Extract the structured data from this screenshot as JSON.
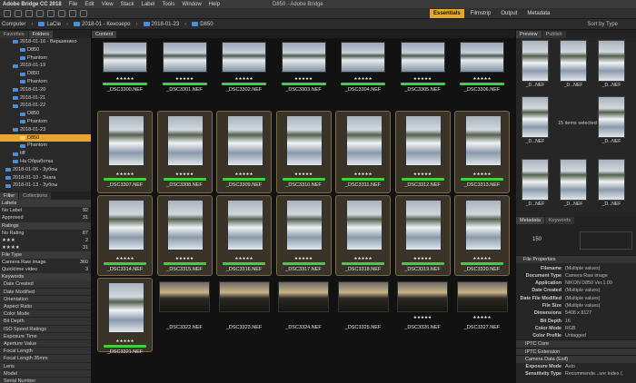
{
  "titlebar": {
    "app_name": "Adobe Bridge CC 2018",
    "menu": [
      "File",
      "Edit",
      "View",
      "Stack",
      "Label",
      "Tools",
      "Window",
      "Help"
    ],
    "window_title": "D850 - Adobe Bridge"
  },
  "toolbar": {
    "workspaces": [
      "Essentials",
      "Filmstrip",
      "Output",
      "Metadata"
    ],
    "active_workspace": "Essentials"
  },
  "path": {
    "crumbs": [
      "Computer",
      "LaCie",
      "2018-01 - Кенозеро",
      "2018-01-23",
      "D850"
    ],
    "sort": "Sort by Type"
  },
  "left": {
    "tabs": [
      "Favorites",
      "Folders"
    ],
    "tree": [
      {
        "label": "2018-01-16 - Вершинино",
        "indent": 14
      },
      {
        "label": "D850",
        "indent": 22
      },
      {
        "label": "Phantom",
        "indent": 22
      },
      {
        "label": "2018-01-19",
        "indent": 14
      },
      {
        "label": "D850",
        "indent": 22
      },
      {
        "label": "Phantom",
        "indent": 22
      },
      {
        "label": "2018-01-20",
        "indent": 14
      },
      {
        "label": "2018-01-21",
        "indent": 14
      },
      {
        "label": "2018-01-22",
        "indent": 14
      },
      {
        "label": "D850",
        "indent": 22
      },
      {
        "label": "Phantom",
        "indent": 22
      },
      {
        "label": "2018-01-23",
        "indent": 14
      },
      {
        "label": "D850",
        "indent": 22,
        "selected": true
      },
      {
        "label": "Phantom",
        "indent": 22
      },
      {
        "label": "tiff",
        "indent": 14
      },
      {
        "label": "На Обработка",
        "indent": 14
      },
      {
        "label": "2018-01-06 - Зубоы",
        "indent": 6
      },
      {
        "label": "2018-01-10 - Знага",
        "indent": 6
      },
      {
        "label": "2018-01-13 - Зубоы",
        "indent": 6
      }
    ],
    "filter_tabs": [
      "Filter",
      "Collections"
    ],
    "filter_rows": [
      {
        "type": "head",
        "label": "Labels"
      },
      {
        "type": "row",
        "label": "No Label",
        "count": "92"
      },
      {
        "type": "row",
        "label": "Approved",
        "count": "31"
      },
      {
        "type": "head",
        "label": "Ratings"
      },
      {
        "type": "row",
        "label": "No Rating",
        "count": "87"
      },
      {
        "type": "row",
        "label": "★★★",
        "count": "2"
      },
      {
        "type": "row",
        "label": "★★★★",
        "count": "31"
      },
      {
        "type": "head",
        "label": "File Type"
      },
      {
        "type": "row",
        "label": "Camera Raw image",
        "count": "360"
      },
      {
        "type": "row",
        "label": "Quicktime video",
        "count": "3"
      },
      {
        "type": "head",
        "label": "Keywords"
      },
      {
        "type": "cat",
        "label": "Date Created"
      },
      {
        "type": "cat",
        "label": "Date Modified"
      },
      {
        "type": "cat",
        "label": "Orientation"
      },
      {
        "type": "cat",
        "label": "Aspect Ratio"
      },
      {
        "type": "cat",
        "label": "Color Mode"
      },
      {
        "type": "cat",
        "label": "Bit Depth"
      },
      {
        "type": "cat",
        "label": "ISO Speed Ratings"
      },
      {
        "type": "cat",
        "label": "Exposure Time"
      },
      {
        "type": "cat",
        "label": "Aperture Value"
      },
      {
        "type": "cat",
        "label": "Focal Length"
      },
      {
        "type": "cat",
        "label": "Focal Length 35mm"
      },
      {
        "type": "cat",
        "label": "Lens"
      },
      {
        "type": "cat",
        "label": "Model"
      },
      {
        "type": "cat",
        "label": "Serial Number"
      },
      {
        "type": "cat",
        "label": "White Balance"
      }
    ]
  },
  "content": {
    "tab": "Content",
    "thumbnails": [
      {
        "name": "_DSC3300.NEF",
        "stars": "★★★★★",
        "selected": false,
        "style": "winter-wide"
      },
      {
        "name": "_DSC3301.NEF",
        "stars": "★★★★★",
        "selected": false,
        "style": "winter-wide"
      },
      {
        "name": "_DSC3302.NEF",
        "stars": "★★★★★",
        "selected": false,
        "style": "winter-wide"
      },
      {
        "name": "_DSC3303.NEF",
        "stars": "★★★★★",
        "selected": false,
        "style": "winter-wide"
      },
      {
        "name": "_DSC3304.NEF",
        "stars": "★★★★★",
        "selected": false,
        "style": "winter-wide"
      },
      {
        "name": "_DSC3305.NEF",
        "stars": "★★★★★",
        "selected": false,
        "style": "winter-wide"
      },
      {
        "name": "_DSC3306.NEF",
        "stars": "★★★★★",
        "selected": false,
        "style": "winter-wide"
      },
      {
        "name": "_DSC3307.NEF",
        "stars": "★★★★★",
        "selected": true,
        "style": "winter-tall"
      },
      {
        "name": "_DSC3308.NEF",
        "stars": "★★★★★",
        "selected": true,
        "style": "winter-tall"
      },
      {
        "name": "_DSC3309.NEF",
        "stars": "★★★★★",
        "selected": true,
        "style": "winter-tall"
      },
      {
        "name": "_DSC3310.NEF",
        "stars": "★★★★★",
        "selected": true,
        "style": "winter-tall"
      },
      {
        "name": "_DSC3311.NEF",
        "stars": "★★★★★",
        "selected": true,
        "style": "winter-tall"
      },
      {
        "name": "_DSC3312.NEF",
        "stars": "★★★★★",
        "selected": true,
        "style": "winter-tall"
      },
      {
        "name": "_DSC3313.NEF",
        "stars": "★★★★★",
        "selected": true,
        "style": "winter-tall"
      },
      {
        "name": "_DSC3314.NEF",
        "stars": "★★★★★",
        "selected": true,
        "style": "winter-tall"
      },
      {
        "name": "_DSC3315.NEF",
        "stars": "★★★★★",
        "selected": true,
        "style": "winter-tall"
      },
      {
        "name": "_DSC3316.NEF",
        "stars": "★★★★★",
        "selected": true,
        "style": "winter-tall"
      },
      {
        "name": "_DSC3317.NEF",
        "stars": "★★★★★",
        "selected": true,
        "style": "winter-tall"
      },
      {
        "name": "_DSC3318.NEF",
        "stars": "★★★★★",
        "selected": true,
        "style": "winter-tall"
      },
      {
        "name": "_DSC3319.NEF",
        "stars": "★★★★★",
        "selected": true,
        "style": "winter-tall"
      },
      {
        "name": "_DSC3320.NEF",
        "stars": "★★★★★",
        "selected": true,
        "style": "winter-tall"
      },
      {
        "name": "_DSC3321.NEF",
        "stars": "★★★★★",
        "selected": true,
        "style": "winter-tall"
      },
      {
        "name": "_DSC3322.NEF",
        "stars": "",
        "selected": false,
        "style": "sunset"
      },
      {
        "name": "_DSC3323.NEF",
        "stars": "",
        "selected": false,
        "style": "sunset"
      },
      {
        "name": "_DSC3324.NEF",
        "stars": "",
        "selected": false,
        "style": "sunset"
      },
      {
        "name": "_DSC3325.NEF",
        "stars": "",
        "selected": false,
        "style": "sunset"
      },
      {
        "name": "_DSC3326.NEF",
        "stars": "★★★★★",
        "selected": false,
        "style": "sunset"
      },
      {
        "name": "_DSC3327.NEF",
        "stars": "★★★★★",
        "selected": false,
        "style": "sunset"
      }
    ]
  },
  "right": {
    "tabs": [
      "Preview",
      "Publish"
    ],
    "preview_names": [
      "_D...NEF",
      "_D...NEF",
      "_D...NEF",
      "_D...NEF"
    ],
    "items_selected": "15 items selected",
    "meta_tabs": [
      "Metadata",
      "Keywords"
    ],
    "iso_value": "150",
    "file_properties_title": "File Properties",
    "properties": [
      {
        "k": "Filename",
        "v": "(Multiple values)"
      },
      {
        "k": "Document Type",
        "v": "Camera Raw image"
      },
      {
        "k": "Application",
        "v": "NIKON D850 Ver.1.00"
      },
      {
        "k": "Date Created",
        "v": "(Multiple values)"
      },
      {
        "k": "Date File Modified",
        "v": "(Multiple values)"
      },
      {
        "k": "File Size",
        "v": "(Multiple values)"
      },
      {
        "k": "Dimensions",
        "v": "5408 x 8127"
      },
      {
        "k": "Bit Depth",
        "v": "16"
      },
      {
        "k": "Color Mode",
        "v": "RGB"
      },
      {
        "k": "Color Profile",
        "v": "Untagged"
      }
    ],
    "sections": [
      "IPTC Core",
      "IPTC Extension",
      "Camera Data (Exif)"
    ],
    "exif": [
      {
        "k": "Exposure Mode",
        "v": "Auto"
      },
      {
        "k": "Sensitivity Type",
        "v": "Recommende...ure Index (."
      }
    ]
  },
  "colors": {
    "accent": "#e8a530",
    "label_green": "#3ed13e",
    "folder": "#4d8fd6"
  }
}
